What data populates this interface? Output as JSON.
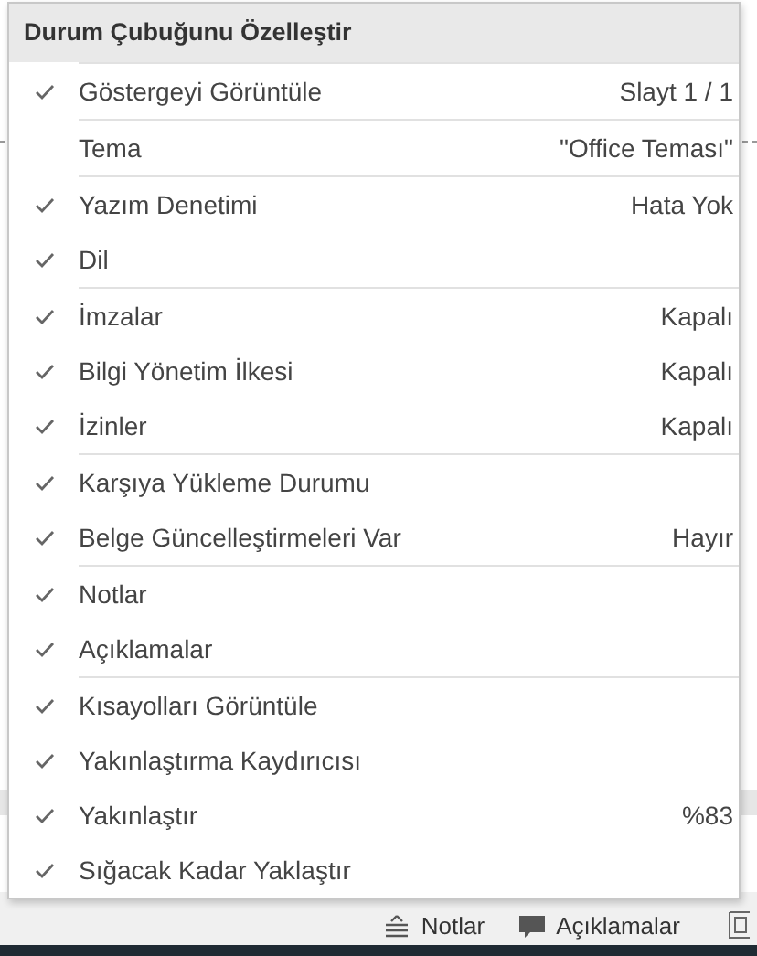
{
  "menu": {
    "title": "Durum Çubuğunu Özelleştir",
    "groups": [
      [
        {
          "label": "Göstergeyi Görüntüle",
          "value": "Slayt 1 / 1",
          "checked": true
        }
      ],
      [
        {
          "label": "Tema",
          "value": "\"Office Teması\"",
          "checked": false
        }
      ],
      [
        {
          "label": "Yazım Denetimi",
          "value": "Hata Yok",
          "checked": true
        },
        {
          "label": "Dil",
          "checked": true
        }
      ],
      [
        {
          "label": "İmzalar",
          "value": "Kapalı",
          "checked": true
        },
        {
          "label": "Bilgi Yönetim İlkesi",
          "value": "Kapalı",
          "checked": true
        },
        {
          "label": "İzinler",
          "value": "Kapalı",
          "checked": true
        }
      ],
      [
        {
          "label": "Karşıya Yükleme Durumu",
          "checked": true
        },
        {
          "label": "Belge Güncelleştirmeleri Var",
          "value": "Hayır",
          "checked": true
        }
      ],
      [
        {
          "label": "Notlar",
          "checked": true
        },
        {
          "label": "Açıklamalar",
          "checked": true
        }
      ],
      [
        {
          "label": "Kısayolları Görüntüle",
          "checked": true
        },
        {
          "label": "Yakınlaştırma Kaydırıcısı",
          "checked": true
        },
        {
          "label": "Yakınlaştır",
          "value": "%83",
          "checked": true
        },
        {
          "label": "Sığacak Kadar Yaklaştır",
          "checked": true
        }
      ]
    ]
  },
  "status_bar": {
    "buttons": [
      {
        "kind": "notes",
        "label": "Notlar"
      },
      {
        "kind": "comments",
        "label": "Açıklamalar"
      }
    ]
  }
}
